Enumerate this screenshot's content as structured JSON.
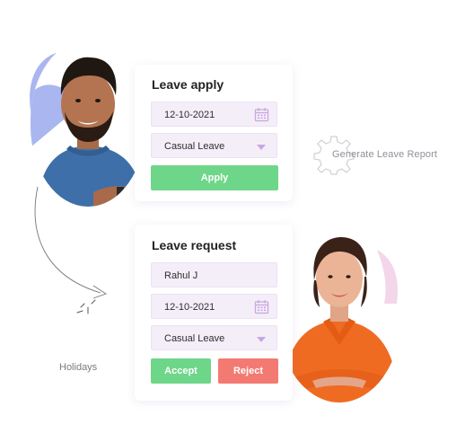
{
  "leave_apply": {
    "title": "Leave apply",
    "date_value": "12-10-2021",
    "leave_type": "Casual Leave",
    "apply_label": "Apply"
  },
  "leave_request": {
    "title": "Leave request",
    "employee_name": "Rahul J",
    "date_value": "12-10-2021",
    "leave_type": "Casual Leave",
    "accept_label": "Accept",
    "reject_label": "Reject"
  },
  "side_links": {
    "generate_report": "Generate Leave Report",
    "holidays": "Holidays"
  },
  "colors": {
    "accept_green": "#6ed689",
    "reject_red": "#f27a72",
    "field_lavender": "#f4eef9",
    "icon_purple": "#c9a6e0",
    "blob_blue": "#a9b6f0"
  },
  "icons": [
    "calendar-icon",
    "chevron-down-icon",
    "gear-icon",
    "arrow-icon"
  ]
}
